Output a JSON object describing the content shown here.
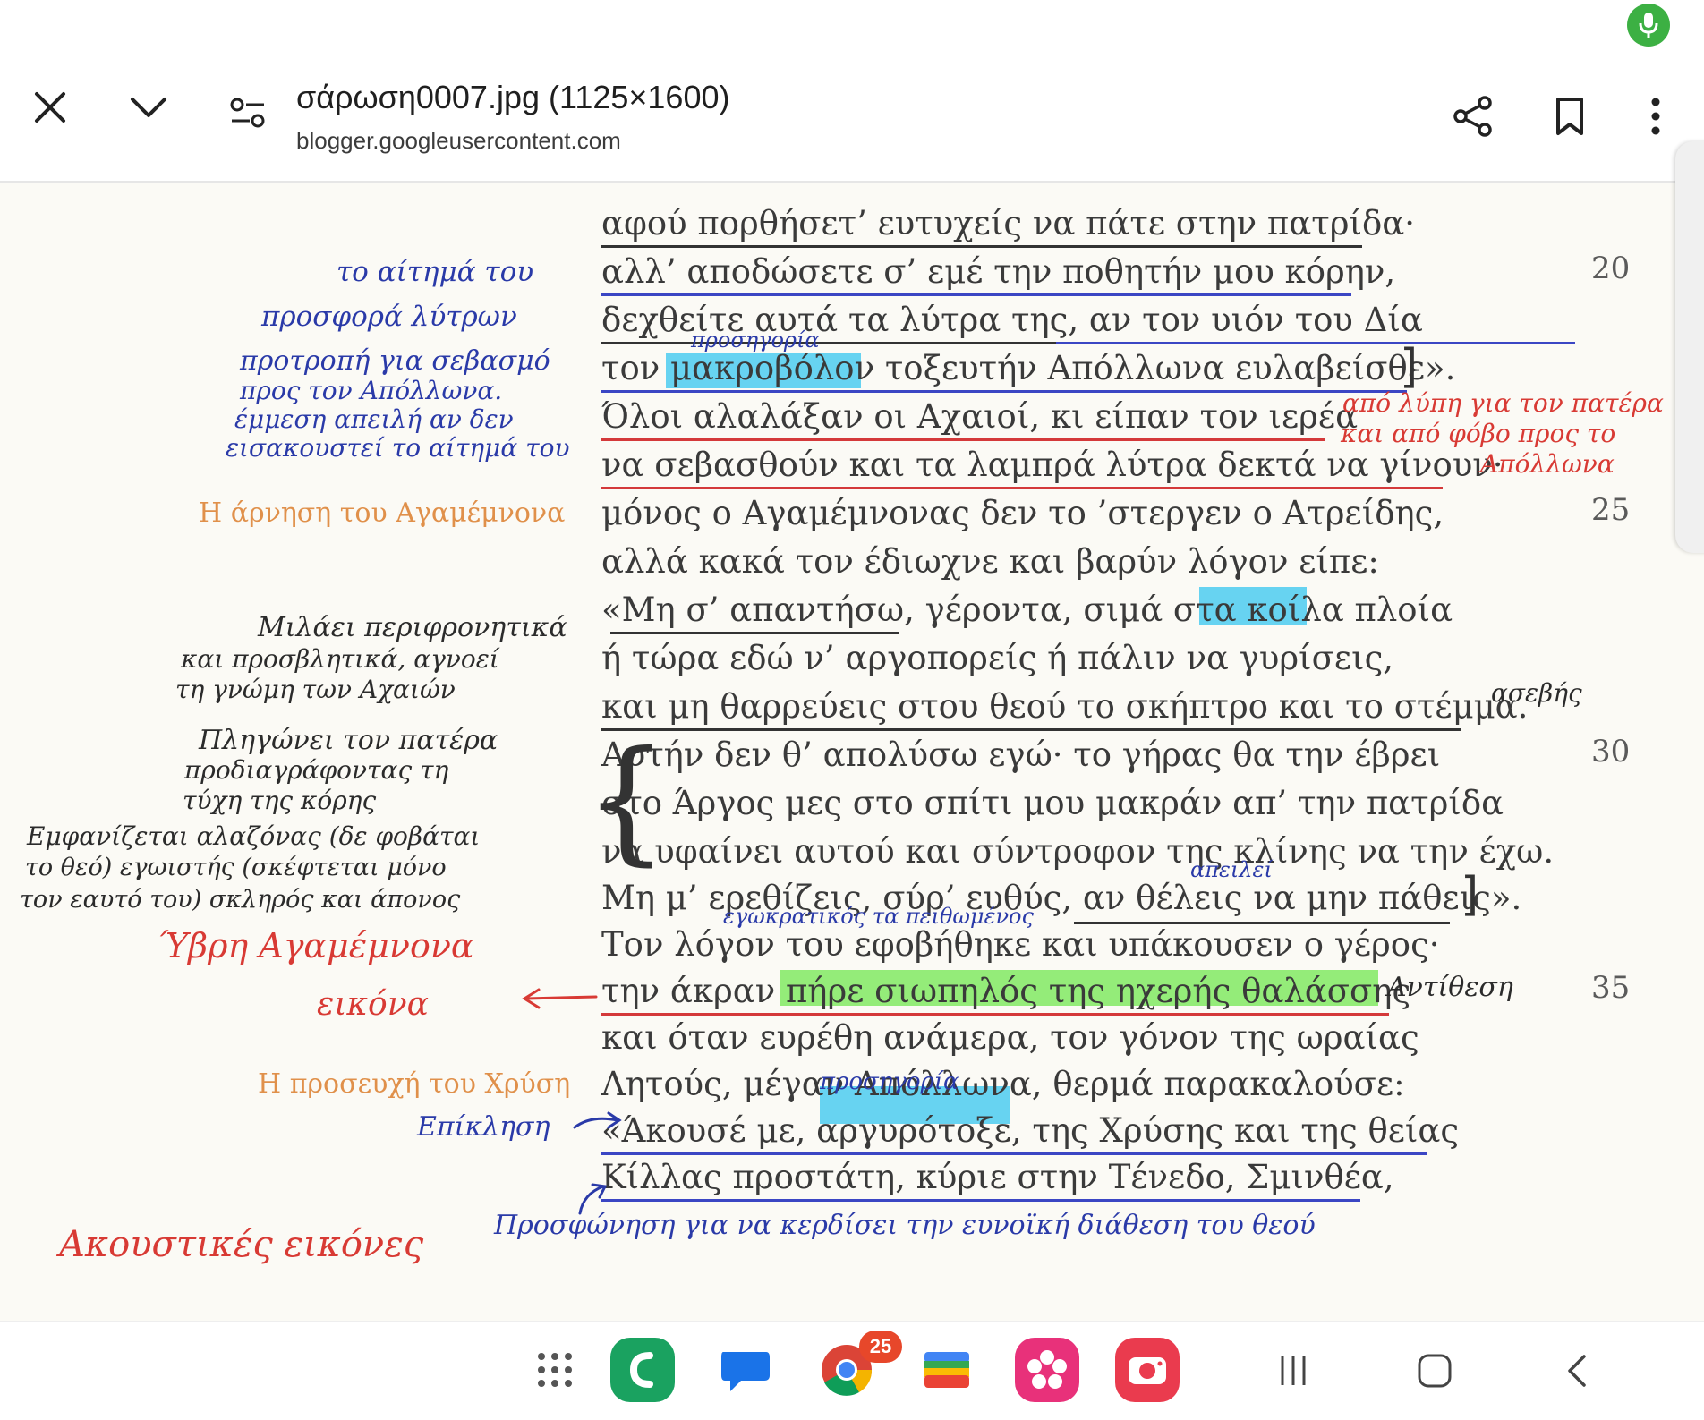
{
  "header": {
    "title": "σάρωση0007.jpg (1125×1600)",
    "host": "blogger.googleusercontent.com"
  },
  "poem": {
    "lines": [
      "αφού πορθήσετ’ ευτυχείς να πάτε στην πατρίδα·",
      "αλλ’ αποδώσετε σ’ εμέ την ποθητήν μου κόρην,",
      "δεχθείτε αυτά τα λύτρα της, αν τον υιόν του Δία",
      "τον μακροβόλον τοξευτήν Απόλλωνα ευλαβείσθε».",
      "Όλοι αλαλάξαν οι Αχαιοί, κι είπαν τον ιερέα",
      "να σεβασθούν και τα λαμπρά λύτρα δεκτά να γίνουν·",
      "μόνος ο Αγαμέμνονας δεν το ’στεργεν ο Ατρείδης,",
      "αλλά κακά τον έδιωχνε και βαρύν λόγον είπε:",
      "«Μη σ’ απαντήσω, γέροντα, σιμά στα κοίλα πλοία",
      "ή τώρα εδώ ν’ αργοπορείς ή πάλιν να γυρίσεις,",
      "και μη θαρρεύεις στου θεού το σκήπτρο και το στέμμα.",
      "Αυτήν δεν θ’ απολύσω εγώ· το γήρας θα την έβρει",
      "στο Άργος μες στο σπίτι μου μακράν απ’ την πατρίδα",
      "να υφαίνει αυτού και σύντροφον της κλίνης να την έχω.",
      "Μη μ’ ερεθίζεις, σύρ’ ευθύς, αν θέλεις να μην πάθεις».",
      "Τον λόγον του εφοβήθηκε και υπάκουσεν ο γέρος·",
      "την άκραν πήρε σιωπηλός της ηχερής θαλάσσης",
      "και όταν ευρέθη ανάμερα, τον γόνον της ωραίας",
      "Λητούς, μέγαν Απόλλωνα, θερμά παρακαλούσε:",
      "«Άκουσέ με, αργυρότοξε, της Χρύσης και της θείας",
      "Κίλλας προστάτη, κύριε στην Τένεδο, Σμινθέα,"
    ],
    "line_numbers": [
      "20",
      "25",
      "30",
      "35"
    ]
  },
  "side_headings": [
    "Η άρνηση του Αγαμέμνονα",
    "Η προσευχή του Χρύση"
  ],
  "annotations": {
    "blue": [
      "το αίτημά του",
      "προσφορά λύτρων",
      "προτροπή για σεβασμό",
      "προς τον Απόλλωνα.",
      "έμμεση απειλή αν δεν",
      "εισακουστεί το αίτημά του",
      "προσηγορία",
      "απειλεί",
      "εγωκρατικός τα πειθωμένος",
      "Επίκληση",
      "προσηγορία",
      "Προσφώνηση για να κερδίσει την ευνοϊκή διάθεση του θεού"
    ],
    "dark": [
      "Μιλάει περιφρονητικά",
      "και προσβλητικά, αγνοεί",
      "τη γνώμη των Αχαιών",
      "Πληγώνει τον πατέρα",
      "προδιαγράφοντας τη",
      "τύχη της κόρης",
      "Εμφανίζεται αλαζόνας (δε φοβάται",
      "το θεό) εγωιστής (σκέφτεται μόνο",
      "τον εαυτό του) σκληρός και άπονος",
      "ασεβής",
      "Αντίθεση"
    ],
    "red": [
      "από λύπη για τον πατέρα",
      "και από φόβο προς το",
      "Απόλλωνα",
      "Ύβρη Αγαμέμνονα",
      "εικόνα",
      "Ακουστικές εικόνες"
    ]
  },
  "taskbar": {
    "chrome_badge": "25"
  },
  "colors": {
    "mic": "#3cb043",
    "badge": "#e7472a",
    "highlight_cyan": "#35c6ef",
    "highlight_green": "#7ae85a"
  }
}
